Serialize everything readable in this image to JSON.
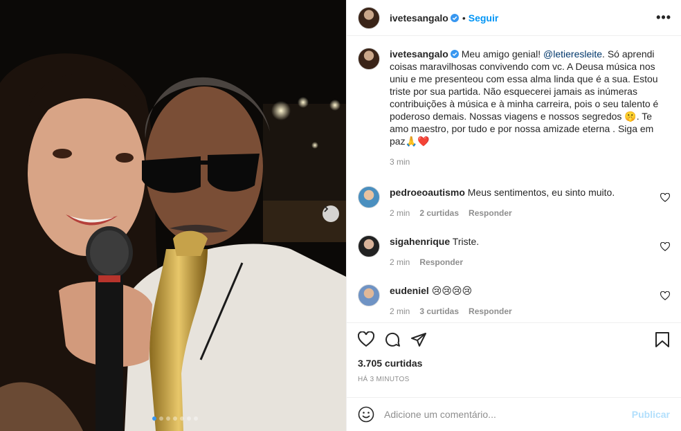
{
  "header": {
    "username": "ivetesangalo",
    "separator": "•",
    "follow_label": "Seguir",
    "more_label": "•••"
  },
  "caption": {
    "username": "ivetesangalo",
    "text_before": "Meu amigo genial! ",
    "mention": "@letieresleite",
    "text_after": ". Só aprendi coisas maravilhosas convivendo com vc. A Deusa música nos uniu e me presenteou com essa alma linda que é a sua. Estou triste por sua partida. Não esquecerei jamais as inúmeras contribuições à música e à minha carreira, pois o seu talento é poderoso demais. Nossas viagens e nossos segredos 🤫. Te amo maestro, por tudo e por nossa amizade eterna . Siga em paz🙏❤️",
    "time": "3 min"
  },
  "comments": [
    {
      "username": "pedroeoautismo",
      "text": "Meus sentimentos, eu sinto muito.",
      "time": "2 min",
      "likes": "2 curtidas",
      "reply": "Responder"
    },
    {
      "username": "sigahenrique",
      "text": "Triste.",
      "time": "2 min",
      "likes": "",
      "reply": "Responder"
    },
    {
      "username": "eudeniel",
      "text": "😢😢😢😢",
      "time": "2 min",
      "likes": "3 curtidas",
      "reply": "Responder"
    }
  ],
  "actions": {
    "likes_count": "3.705 curtidas",
    "posted_ago": "HÁ 3 MINUTOS"
  },
  "add_comment": {
    "placeholder": "Adicione um comentário...",
    "publish_label": "Publicar"
  },
  "carousel": {
    "total_slides": 7,
    "active_slide": 1
  },
  "colors": {
    "accent": "#0095f6",
    "verified": "#3897f0",
    "muted": "#8e8e8e",
    "publish_disabled": "#b2dffc",
    "heart_red": "#ed4956"
  },
  "icons": [
    "verified-badge-icon",
    "more-options-icon",
    "heart-icon",
    "comment-icon",
    "share-icon",
    "bookmark-icon",
    "emoji-icon",
    "chevron-right-icon"
  ]
}
